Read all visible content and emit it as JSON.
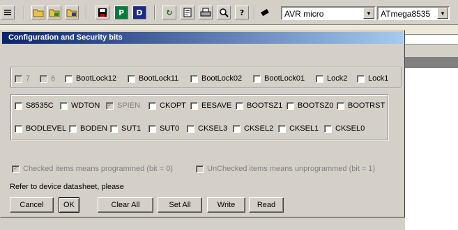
{
  "toolbar": {
    "device_family": "AVR micro",
    "device_model": "ATmega8535",
    "reload_glyph": "↻",
    "program_glyph": "P",
    "data_glyph": "D",
    "help_glyph": "?",
    "dropdown_arrow": "▼"
  },
  "dialog": {
    "title": "Configuration and Security bits",
    "lock_bits": [
      {
        "label": "7",
        "checked": false,
        "disabled": true
      },
      {
        "label": "6",
        "checked": false,
        "disabled": true
      },
      {
        "label": "BootLock12",
        "checked": false,
        "disabled": false
      },
      {
        "label": "BootLock11",
        "checked": false,
        "disabled": false
      },
      {
        "label": "BootLock02",
        "checked": false,
        "disabled": false
      },
      {
        "label": "BootLock01",
        "checked": false,
        "disabled": false
      },
      {
        "label": "Lock2",
        "checked": false,
        "disabled": false
      },
      {
        "label": "Lock1",
        "checked": false,
        "disabled": false
      }
    ],
    "fuse_row1": [
      {
        "label": "S8535C",
        "checked": false,
        "disabled": false
      },
      {
        "label": "WDTON",
        "checked": false,
        "disabled": false
      },
      {
        "label": "SPIEN",
        "checked": true,
        "disabled": true
      },
      {
        "label": "CKOPT",
        "checked": false,
        "disabled": false
      },
      {
        "label": "EESAVE",
        "checked": false,
        "disabled": false
      },
      {
        "label": "BOOTSZ1",
        "checked": false,
        "disabled": false
      },
      {
        "label": "BOOTSZ0",
        "checked": false,
        "disabled": false
      },
      {
        "label": "BOOTRST",
        "checked": false,
        "disabled": false
      }
    ],
    "fuse_row2": [
      {
        "label": "BODLEVEL",
        "checked": false,
        "disabled": false
      },
      {
        "label": "BODEN",
        "checked": false,
        "disabled": false
      },
      {
        "label": "SUT1",
        "checked": false,
        "disabled": false
      },
      {
        "label": "SUT0",
        "checked": false,
        "disabled": false
      },
      {
        "label": "CKSEL3",
        "checked": false,
        "disabled": false
      },
      {
        "label": "CKSEL2",
        "checked": false,
        "disabled": false
      },
      {
        "label": "CKSEL1",
        "checked": false,
        "disabled": false
      },
      {
        "label": "CKSEL0",
        "checked": false,
        "disabled": false
      }
    ],
    "legend_checked": "Checked items means programmed (bit = 0)",
    "legend_unchecked": "UnChecked items means unprogrammed (bit = 1)",
    "reference_note": "Refer to device datasheet, please",
    "buttons": {
      "cancel": "Cancel",
      "ok": "OK",
      "clear_all": "Clear All",
      "set_all": "Set All",
      "write": "Write",
      "read": "Read"
    }
  },
  "checkmark_glyph": "✓"
}
